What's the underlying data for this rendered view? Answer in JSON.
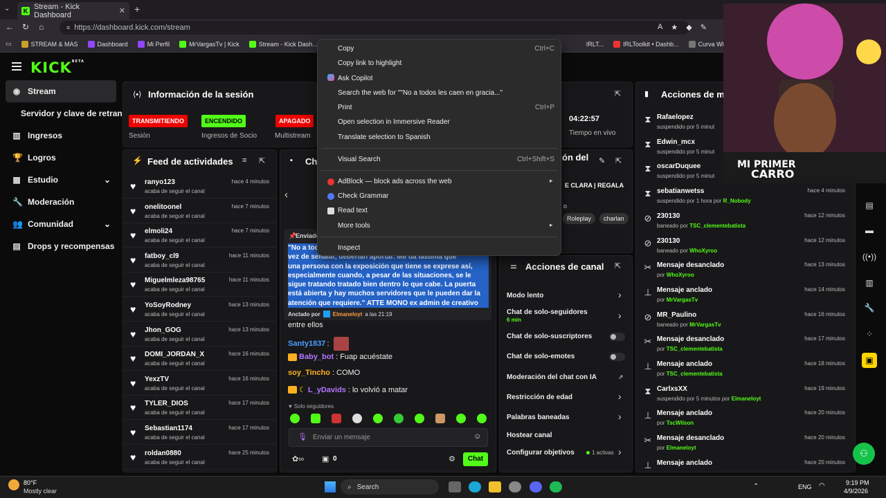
{
  "browser": {
    "tab_title": "Stream - Kick Dashboard",
    "url": "https://dashboard.kick.com/stream",
    "bookmarks": [
      "STREAM & MAS",
      "Dashboard",
      "Mi Perfil",
      "MrVargasTv | Kick",
      "Stream - Kick Dash...",
      "IRLT...",
      "IRLToolkit • Dashb...",
      "Curva Wheels CFF76"
    ]
  },
  "sidebar": {
    "logo": "KICK",
    "logo_sup": "BETA",
    "items": [
      {
        "label": "Stream"
      },
      {
        "label": "Servidor y clave de retransm"
      },
      {
        "label": "Ingresos"
      },
      {
        "label": "Logros"
      },
      {
        "label": "Estudio"
      },
      {
        "label": "Moderación"
      },
      {
        "label": "Comunidad"
      },
      {
        "label": "Drops y recompensas"
      }
    ]
  },
  "session": {
    "title": "Información de la sesión",
    "badges": [
      {
        "text": "TRANSMITIENDO",
        "label": "Sesión",
        "color": "#eb0400"
      },
      {
        "text": "ENCENDIDO",
        "label": "Ingresos de Socio",
        "color": "#53fc18"
      },
      {
        "text": "APAGADO",
        "label": "Multistream",
        "color": "#eb0400"
      }
    ],
    "uptime": "04:22:57",
    "uptime_label": "Tiempo en vivo"
  },
  "feed": {
    "title": "Feed de actividades",
    "items": [
      {
        "user": "ranyo123",
        "sub": "acaba de seguir el canal",
        "time": "hace 4 minutos"
      },
      {
        "user": "onelitoonel",
        "sub": "acaba de seguir el canal",
        "time": "hace 7 minutos"
      },
      {
        "user": "elmoli24",
        "sub": "acaba de seguir el canal",
        "time": "hace 7 minutos"
      },
      {
        "user": "fatboy_cl9",
        "sub": "acaba de seguir el canal",
        "time": "hace 11 minutos"
      },
      {
        "user": "Miguelmleza98765",
        "sub": "acaba de seguir el canal",
        "time": "hace 11 minutos"
      },
      {
        "user": "YoSoyRodney",
        "sub": "acaba de seguir el canal",
        "time": "hace 13 minutos"
      },
      {
        "user": "Jhon_GOG",
        "sub": "acaba de seguir el canal",
        "time": "hace 13 minutos"
      },
      {
        "user": "DOMI_JORDAN_X",
        "sub": "acaba de seguir el canal",
        "time": "hace 16 minutos"
      },
      {
        "user": "YexzTV",
        "sub": "acaba de seguir el canal",
        "time": "hace 16 minutos"
      },
      {
        "user": "TYLER_DIOS",
        "sub": "acaba de seguir el canal",
        "time": "hace 17 minutos"
      },
      {
        "user": "Sebastian1174",
        "sub": "acaba de seguir el canal",
        "time": "hace 17 minutos"
      },
      {
        "user": "roldan0880",
        "sub": "acaba de seguir el canal",
        "time": "hace 25 minutos"
      }
    ]
  },
  "chat": {
    "title": "Ch",
    "pinned_label": "Enviado",
    "pinned_lines": [
      "\"No a tod",
      "vez de señalar, deberían aportar. Me da lástima que",
      "una persona con la exposición que tiene se exprese así,",
      "especialmente cuando, a pesar de las situaciones, se le",
      "sigue tratando tratado bien dentro lo que cabe. La puerta",
      "está abierta y hay muchos servidores que le pueden dar la",
      "atención que requiere.\" ATTE MONO ex admin de creativo"
    ],
    "pinned_by_prefix": "Anclado por",
    "pinned_by_user": "Elmaneloyt",
    "pinned_by_time": "a las 21:19",
    "overflow": "entre ellos",
    "messages": [
      {
        "user": "Santy1837",
        "text": "",
        "color": "#4a9eff"
      },
      {
        "user": "Baby_bot",
        "text": "Fuap acuéstate",
        "color": "#b473ff"
      },
      {
        "user": "soy_Tincho",
        "text": "COMO",
        "color": "#ffb020"
      },
      {
        "user": "L_yDavids",
        "text": "lo volvió a matar",
        "color": "#b473ff"
      }
    ],
    "followers_only": "Solo seguidores",
    "input_placeholder": "Enviar un mensaje",
    "points": "0",
    "send": "Chat"
  },
  "info": {
    "title_fragment": "ón del",
    "stream_title": "E CLARA | REGALA",
    "category_fragment": "o",
    "tags": [
      "Roleplay",
      "charlan"
    ]
  },
  "channel_actions": {
    "title": "Acciones de canal",
    "rows": [
      {
        "label": "Modo lento",
        "sub": "",
        "kind": "chevron"
      },
      {
        "label": "Chat de solo-seguidores",
        "sub": "6 min",
        "kind": "chevron"
      },
      {
        "label": "Chat de solo-suscriptores",
        "sub": "",
        "kind": "toggle"
      },
      {
        "label": "Chat de solo-emotes",
        "sub": "",
        "kind": "toggle"
      },
      {
        "label": "Moderación del chat con IA",
        "sub": "",
        "kind": "link"
      },
      {
        "label": "Restricción de edad",
        "sub": "",
        "kind": "chevron"
      },
      {
        "label": "Palabras baneadas",
        "sub": "",
        "kind": "chevron"
      },
      {
        "label": "Hostear canal",
        "sub": "",
        "kind": "none"
      },
      {
        "label": "Configurar objetivos",
        "sub": "",
        "kind": "goals",
        "extra": "1 activas"
      }
    ]
  },
  "mod_actions": {
    "title": "Acciones de mo",
    "items": [
      {
        "name": "Rafaelopez",
        "sub": "suspendido por 5 minut",
        "by": "",
        "time": "",
        "icon": "hourglass"
      },
      {
        "name": "Edwin_mcx",
        "sub": "suspendido por 5 minut",
        "by": "",
        "time": "",
        "icon": "hourglass"
      },
      {
        "name": "oscarDuquee",
        "sub": "suspendido por 5 minut",
        "by": "",
        "time": "",
        "icon": "hourglass"
      },
      {
        "name": "sebatianwetss",
        "sub": "suspendido por 1 hora por",
        "by": "R_Nobody",
        "time": "hace 4 minutos",
        "icon": "hourglass"
      },
      {
        "name": "230130",
        "sub": "baneado por",
        "by": "TSC_clementebatista",
        "time": "hace 12 minutos",
        "icon": "ban"
      },
      {
        "name": "230130",
        "sub": "baneado por",
        "by": "WhoXyroo",
        "time": "hace 12 minutos",
        "icon": "ban"
      },
      {
        "name": "Mensaje desanclado",
        "sub": "por",
        "by": "WhoXyroo",
        "time": "hace 13 minutos",
        "icon": "unpin"
      },
      {
        "name": "Mensaje anclado",
        "sub": "por",
        "by": "MrVargasTv",
        "time": "hace 14 minutos",
        "icon": "pin"
      },
      {
        "name": "MR_Paulino",
        "sub": "baneado por",
        "by": "MrVargasTv",
        "time": "hace 16 minutos",
        "icon": "ban"
      },
      {
        "name": "Mensaje desanclado",
        "sub": "por",
        "by": "TSC_clementebatista",
        "time": "hace 17 minutos",
        "icon": "unpin"
      },
      {
        "name": "Mensaje anclado",
        "sub": "por",
        "by": "TSC_clementebatista",
        "time": "hace 18 minutos",
        "icon": "pin"
      },
      {
        "name": "CarlxsXX",
        "sub": "suspendido por 5 minutos por",
        "by": "Elmaneloyt",
        "time": "hace 19 minutos",
        "icon": "hourglass"
      },
      {
        "name": "Mensaje anclado",
        "sub": "por",
        "by": "TscWilson",
        "time": "hace 20 minutos",
        "icon": "pin"
      },
      {
        "name": "Mensaje desanclado",
        "sub": "por",
        "by": "Elmaneloyt",
        "time": "hace 20 minutos",
        "icon": "unpin"
      },
      {
        "name": "Mensaje anclado",
        "sub": "",
        "by": "",
        "time": "hace 20 minutos",
        "icon": "pin"
      }
    ]
  },
  "context_menu": {
    "items": [
      {
        "label": "Copy",
        "shortcut": "Ctrl+C"
      },
      {
        "label": "Copy link to highlight",
        "shortcut": ""
      },
      {
        "label": "Ask Copilot",
        "shortcut": ""
      },
      {
        "label": "Search the web for \"\"No a todos les caen en gracia...\"",
        "shortcut": ""
      },
      {
        "label": "Print",
        "shortcut": "Ctrl+P"
      },
      {
        "label": "Open selection in Immersive Reader",
        "shortcut": ""
      },
      {
        "label": "Translate selection to Spanish",
        "shortcut": ""
      },
      {
        "label": "Visual Search",
        "shortcut": "Ctrl+Shift+S"
      },
      {
        "label": "AdBlock — block ads across the web",
        "shortcut": ""
      },
      {
        "label": "Check Grammar",
        "shortcut": ""
      },
      {
        "label": "Read text",
        "shortcut": ""
      },
      {
        "label": "More tools",
        "shortcut": ""
      },
      {
        "label": "Inspect",
        "shortcut": ""
      }
    ]
  },
  "webcam": {
    "overlay_line1": "MI PRIMER",
    "overlay_line2": "CARRO"
  },
  "taskbar": {
    "weather_temp": "80°F",
    "weather_desc": "Mostly clear",
    "search": "Search",
    "lang": "ENG",
    "time": "9:19 PM",
    "date": "4/9/2026"
  }
}
